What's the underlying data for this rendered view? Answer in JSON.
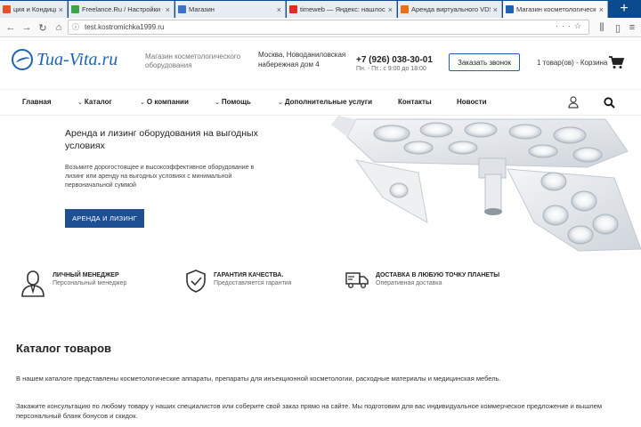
{
  "browser": {
    "tabs": [
      {
        "label": "ция и Кондиционеры - интернет",
        "favicon_color": "#e6522c",
        "active": false
      },
      {
        "label": "Freelance.Ru / Настройки - Ин",
        "favicon_color": "#3fa34d",
        "active": false
      },
      {
        "label": "Магазин",
        "favicon_color": "#3b73c4",
        "active": false
      },
      {
        "label": "timeweb — Яндекс: нашлось",
        "favicon_color": "#e22a2a",
        "active": false
      },
      {
        "label": "Аренда виртуального VDS/V",
        "favicon_color": "#e8701a",
        "active": false
      },
      {
        "label": "Магазин косметологического о",
        "favicon_color": "#1e63b3",
        "active": true
      }
    ],
    "url": "test.kostromichka1999.ru",
    "new_tab_symbol": "+"
  },
  "header": {
    "logo_text": "Tua-Vita.ru",
    "tagline": "Магазин косметологического оборудования",
    "address": "Москва, Новоданиловская набережная дом 4",
    "phone": "+7 (926) 038-30-01",
    "hours": "Пн. - Пт.: с 9:00 до 18:00",
    "callback_label": "Заказать звонок",
    "cart_label": "1 товар(ов) - Корзина"
  },
  "menu": {
    "items": [
      {
        "label": "Главная",
        "dropdown": false
      },
      {
        "label": "Каталог",
        "dropdown": true
      },
      {
        "label": "О компании",
        "dropdown": true
      },
      {
        "label": "Помощь",
        "dropdown": true
      },
      {
        "label": "Дополнительные услуги",
        "dropdown": true
      },
      {
        "label": "Контакты",
        "dropdown": false
      },
      {
        "label": "Новости",
        "dropdown": false
      }
    ]
  },
  "hero": {
    "title": "Аренда и лизинг оборудования на выгодных условиях",
    "description": "Возьмите дорогостоящее и высокоэффективное оборудование в лизинг или аренду на выгодных условиях с минимальной первоначальной суммой",
    "button_label": "АРЕНДА И ЛИЗИНГ",
    "accent_color": "#1d4f92"
  },
  "features": [
    {
      "icon": "manager-icon",
      "title": "ЛИЧНЫЙ МЕНЕДЖЕР",
      "subtitle": "Персональный менеджер"
    },
    {
      "icon": "shield-check-icon",
      "title": "ГАРАНТИЯ КАЧЕСТВА.",
      "subtitle": "Предоставляется гарантия"
    },
    {
      "icon": "truck-icon",
      "title": "ДОСТАВКА В ЛЮБУЮ ТОЧКУ ПЛАНЕТЫ",
      "subtitle": "Оперативная доставка"
    }
  ],
  "catalog": {
    "title": "Каталог товаров",
    "paragraph1": "В нашем каталоге представлены косметологические аппараты, препараты для инъекционной косметологии, расходные материалы и медицинская мебель.",
    "paragraph2": "Закажите консультацию по любому товару у наших специалистов или соберите свой заказ прямо на сайте. Мы подготовим для вас индивидуальное коммерческое предложение и вышлем персональный бланк бонусов и скидок."
  }
}
